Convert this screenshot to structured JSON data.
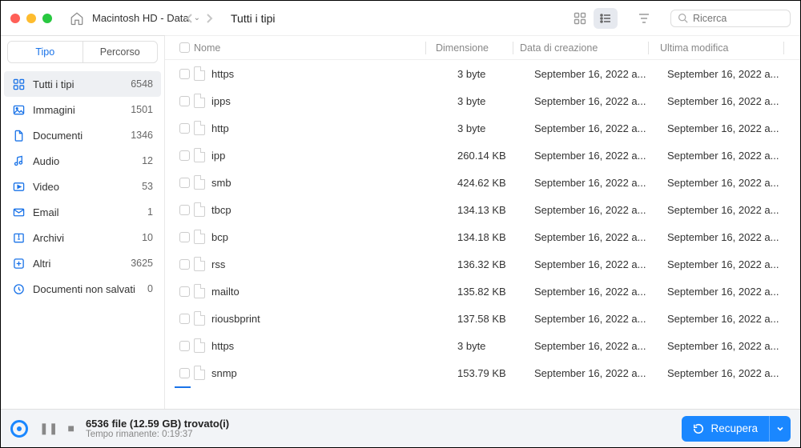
{
  "titlebar": {
    "drive_name": "Macintosh HD - Data"
  },
  "sidebar": {
    "tabs": {
      "type": "Tipo",
      "path": "Percorso"
    },
    "categories": [
      {
        "key": "all",
        "label": "Tutti i tipi",
        "count": "6548",
        "icon": "grid"
      },
      {
        "key": "images",
        "label": "Immagini",
        "count": "1501",
        "icon": "image"
      },
      {
        "key": "docs",
        "label": "Documenti",
        "count": "1346",
        "icon": "document"
      },
      {
        "key": "audio",
        "label": "Audio",
        "count": "12",
        "icon": "audio"
      },
      {
        "key": "video",
        "label": "Video",
        "count": "53",
        "icon": "video"
      },
      {
        "key": "email",
        "label": "Email",
        "count": "1",
        "icon": "email"
      },
      {
        "key": "archive",
        "label": "Archivi",
        "count": "10",
        "icon": "archive"
      },
      {
        "key": "other",
        "label": "Altri",
        "count": "3625",
        "icon": "other"
      },
      {
        "key": "unsaved",
        "label": "Documenti non salvati",
        "count": "0",
        "icon": "unsaved"
      }
    ]
  },
  "toolbar": {
    "breadcrumb": "Tutti i tipi",
    "search_placeholder": "Ricerca"
  },
  "columns": {
    "name": "Nome",
    "size": "Dimensione",
    "created": "Data di creazione",
    "modified": "Ultima modifica"
  },
  "rows": [
    {
      "name": "https",
      "size": "3 byte",
      "created": "September 16, 2022 a...",
      "modified": "September 16, 2022 a..."
    },
    {
      "name": "ipps",
      "size": "3 byte",
      "created": "September 16, 2022 a...",
      "modified": "September 16, 2022 a..."
    },
    {
      "name": "http",
      "size": "3 byte",
      "created": "September 16, 2022 a...",
      "modified": "September 16, 2022 a..."
    },
    {
      "name": "ipp",
      "size": "260.14 KB",
      "created": "September 16, 2022 a...",
      "modified": "September 16, 2022 a..."
    },
    {
      "name": "smb",
      "size": "424.62 KB",
      "created": "September 16, 2022 a...",
      "modified": "September 16, 2022 a..."
    },
    {
      "name": "tbcp",
      "size": "134.13 KB",
      "created": "September 16, 2022 a...",
      "modified": "September 16, 2022 a..."
    },
    {
      "name": "bcp",
      "size": "134.18 KB",
      "created": "September 16, 2022 a...",
      "modified": "September 16, 2022 a..."
    },
    {
      "name": "rss",
      "size": "136.32 KB",
      "created": "September 16, 2022 a...",
      "modified": "September 16, 2022 a..."
    },
    {
      "name": "mailto",
      "size": "135.82 KB",
      "created": "September 16, 2022 a...",
      "modified": "September 16, 2022 a..."
    },
    {
      "name": "riousbprint",
      "size": "137.58 KB",
      "created": "September 16, 2022 a...",
      "modified": "September 16, 2022 a..."
    },
    {
      "name": "https",
      "size": "3 byte",
      "created": "September 16, 2022 a...",
      "modified": "September 16, 2022 a..."
    },
    {
      "name": "snmp",
      "size": "153.79 KB",
      "created": "September 16, 2022 a...",
      "modified": "September 16, 2022 a..."
    }
  ],
  "footer": {
    "found": "6536 file (12.59 GB) trovato(i)",
    "remaining": "Tempo rimanente: 0:19:37",
    "recover_label": "Recupera"
  }
}
